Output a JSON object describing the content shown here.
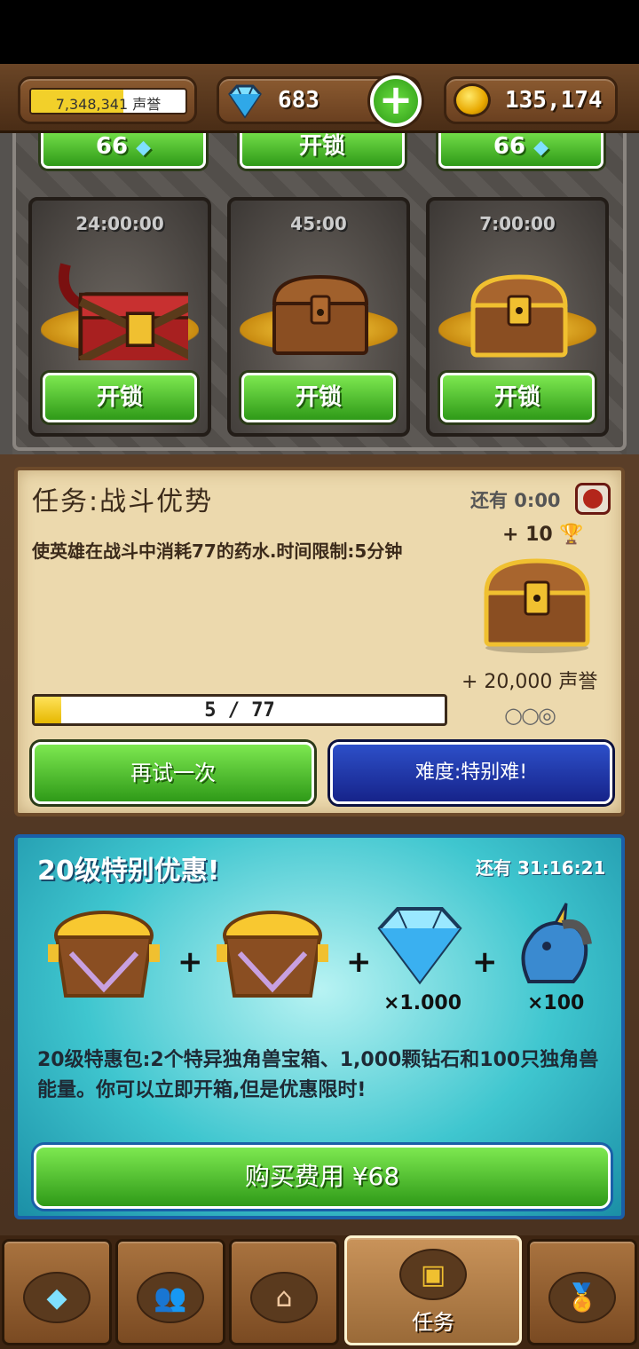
{
  "header": {
    "prestige_text": "7,348,341 声誉",
    "prestige_fill": 0.6,
    "gems": "683",
    "gold": "135,174"
  },
  "chests": {
    "top_row": [
      "66",
      "开锁",
      "66"
    ],
    "slots": [
      {
        "timer": "24:00:00",
        "button": "开锁"
      },
      {
        "timer": "45:00",
        "button": "开锁"
      },
      {
        "timer": "7:00:00",
        "button": "开锁"
      }
    ]
  },
  "quest": {
    "title": "任务:战斗优势",
    "time_left": "还有 0:00",
    "description": "使英雄在战斗中消耗77的药水.时间限制:5分钟",
    "trophy_reward": "+ 10",
    "prestige_reward": "+ 20,000 声誉",
    "progress_text": "5 / 77",
    "progress_fraction": 0.065,
    "retry_label": "再试一次",
    "difficulty_label": "难度:特别难!"
  },
  "offer": {
    "title": "20级特别优惠!",
    "time_left": "还有 31:16:21",
    "gem_qty": "×1.000",
    "unicorn_qty": "×100",
    "description": "20级特惠包:2个特异独角兽宝箱、1,000颗钻石和100只独角兽能量。你可以立即开箱,但是优惠限时!",
    "buy_label": "购买费用 ¥68"
  },
  "nav": {
    "quests_label": "任务"
  },
  "icons": [
    "diamond-icon",
    "plus-icon",
    "coin-icon",
    "trophy-icon",
    "close-icon",
    "unicorn-icon",
    "team-icon",
    "house-icon",
    "medal-icon",
    "chest-icon"
  ],
  "colors": {
    "green_button": "#2f9a18",
    "blue_button": "#16238a",
    "offer_bg": "#3fc6cf"
  }
}
